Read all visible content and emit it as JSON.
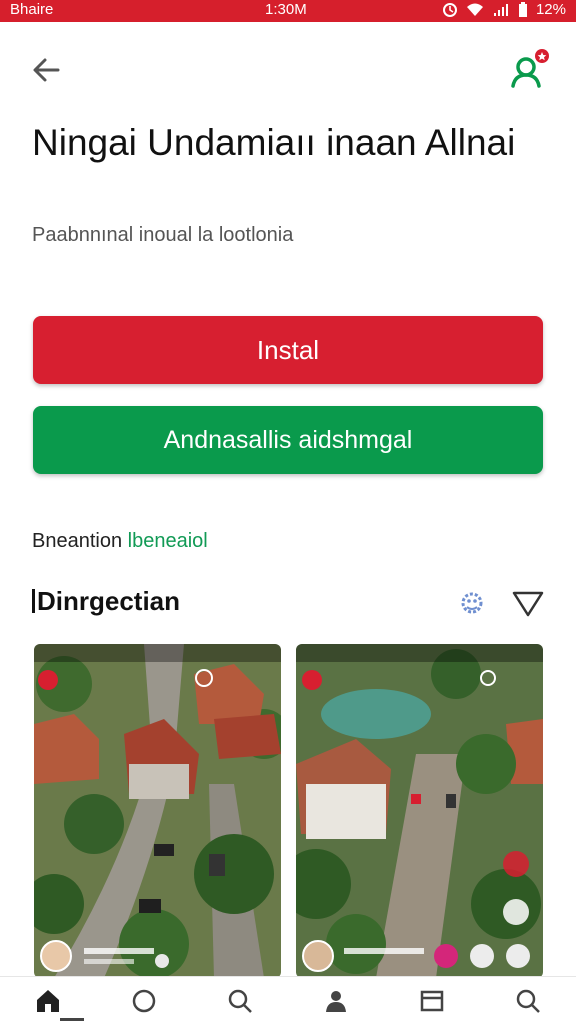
{
  "status_bar": {
    "carrier": "Bhaire",
    "time": "1:30M",
    "battery": "12%"
  },
  "header": {
    "title": "Ningai Undamiaıı inaan Allnai",
    "subtitle": "Paabnnınal inoual la lootlonia"
  },
  "actions": {
    "primary_label": "Instal",
    "secondary_label": "Andnasallis aidshmgal"
  },
  "section": {
    "line_text": "Bneantion",
    "line_highlight": "lbeneaiol",
    "title": "Dinrgectian"
  },
  "gallery": {
    "screenshots": [
      {
        "name": "screenshot-1",
        "description": "aerial village street view"
      },
      {
        "name": "screenshot-2",
        "description": "aerial lake and houses view"
      }
    ]
  },
  "nav": {
    "items": [
      "home-icon",
      "circle-icon",
      "search-icon",
      "person-icon",
      "card-icon",
      "search-icon"
    ]
  },
  "colors": {
    "status_bar": "#d61f2c",
    "primary": "#d71f30",
    "secondary": "#0a9a4c",
    "accent_green": "#119a55"
  }
}
